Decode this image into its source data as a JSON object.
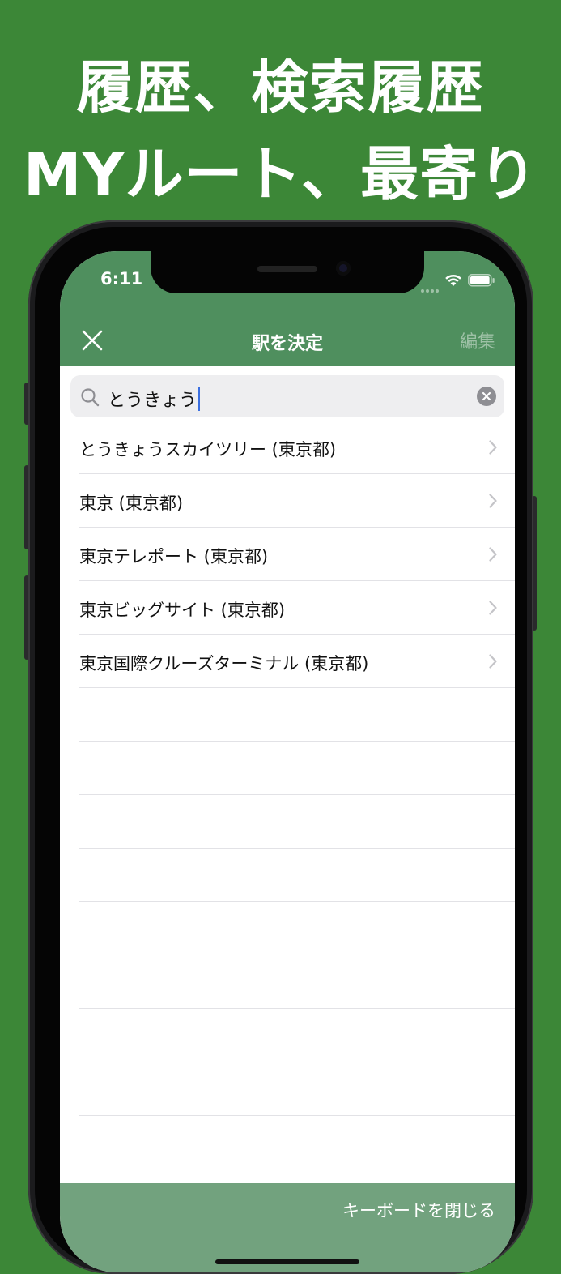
{
  "headline": {
    "line1": "履歴、検索履歴",
    "line2": "MYルート、最寄り"
  },
  "status_bar": {
    "time": "6:11"
  },
  "nav": {
    "title": "駅を決定",
    "edit_label": "編集"
  },
  "search": {
    "value": "とうきょう"
  },
  "results": [
    {
      "label": "とうきょうスカイツリー (東京都)"
    },
    {
      "label": "東京 (東京都)"
    },
    {
      "label": "東京テレポート (東京都)"
    },
    {
      "label": "東京ビッグサイト (東京都)"
    },
    {
      "label": "東京国際クルーズターミナル (東京都)"
    },
    {
      "label": ""
    },
    {
      "label": ""
    },
    {
      "label": ""
    },
    {
      "label": ""
    },
    {
      "label": ""
    },
    {
      "label": ""
    },
    {
      "label": ""
    },
    {
      "label": ""
    },
    {
      "label": ""
    }
  ],
  "footer": {
    "dismiss_keyboard_label": "キーボードを閉じる"
  },
  "colors": {
    "background": "#3c8737",
    "appbar": "#4f8f5e",
    "footer": "#72a27e",
    "caret": "#3b6fe0"
  },
  "icons": {
    "close": "close-icon",
    "search": "search-icon",
    "clear": "clear-icon",
    "chevron": "chevron-right-icon",
    "wifi": "wifi-icon",
    "battery": "battery-icon"
  }
}
